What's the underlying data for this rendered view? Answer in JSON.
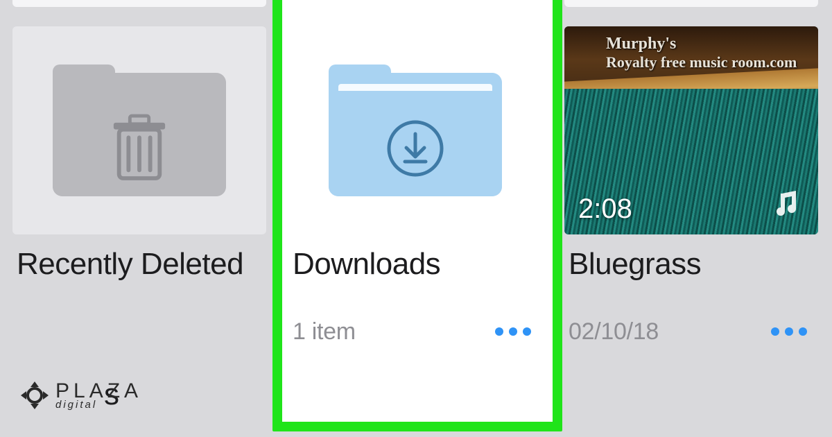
{
  "tiles": {
    "deleted": {
      "title": "Recently Deleted",
      "suffix": "s"
    },
    "downloads": {
      "title": "Downloads",
      "subtitle": "1 item"
    },
    "music": {
      "title": "Bluegrass",
      "subtitle": "02/10/18",
      "duration": "2:08",
      "banner_line1": "Murphy's",
      "banner_line2": "Royalty free music room.com"
    }
  },
  "watermark": {
    "line1": "PLAZA",
    "line2": "digital"
  },
  "colors": {
    "highlight": "#20e41a",
    "accent": "#2f93f6"
  }
}
